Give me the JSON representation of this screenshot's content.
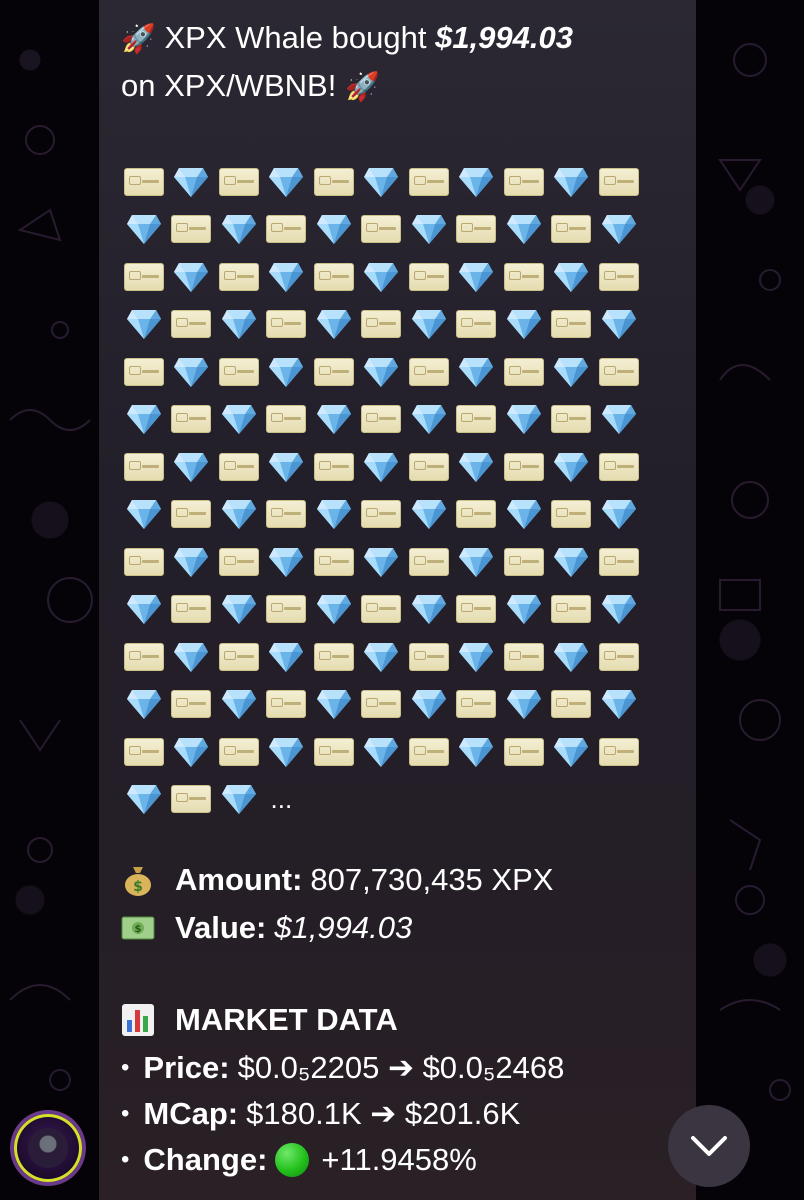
{
  "message": {
    "title_prefix": "XPX Whale bought",
    "title_amount": "$1,994.03",
    "title_line2": "on XPX/WBNB!",
    "ellipsis": "...",
    "amount_label": "Amount:",
    "amount_value": "807,730,435 XPX",
    "value_label": "Value:",
    "value_value": "$1,994.03",
    "market_heading": "MARKET DATA",
    "price_label": "Price:",
    "price_value": "$0.0₅2205 ➔ $0.0₅2468",
    "mcap_label": "MCap:",
    "mcap_value": "$180.1K ➔ $201.6K",
    "change_label": "Change:",
    "change_value": "+11.9458%"
  },
  "icons": {
    "rocket": "rocket-icon",
    "card": "credit-card-icon",
    "diamond": "gem-icon",
    "money_bag": "money-bag-icon",
    "dollar": "dollar-banknote-icon",
    "chart": "bar-chart-icon",
    "green_circle": "green-circle-icon"
  },
  "grid_pattern": {
    "rows": 14,
    "full_row_cells": 11,
    "last_row_cells": 3
  },
  "colors": {
    "bubble": "#2b2833",
    "diamond": "#7ec2f5",
    "card": "#efe7c4",
    "green": "#22c01c"
  }
}
